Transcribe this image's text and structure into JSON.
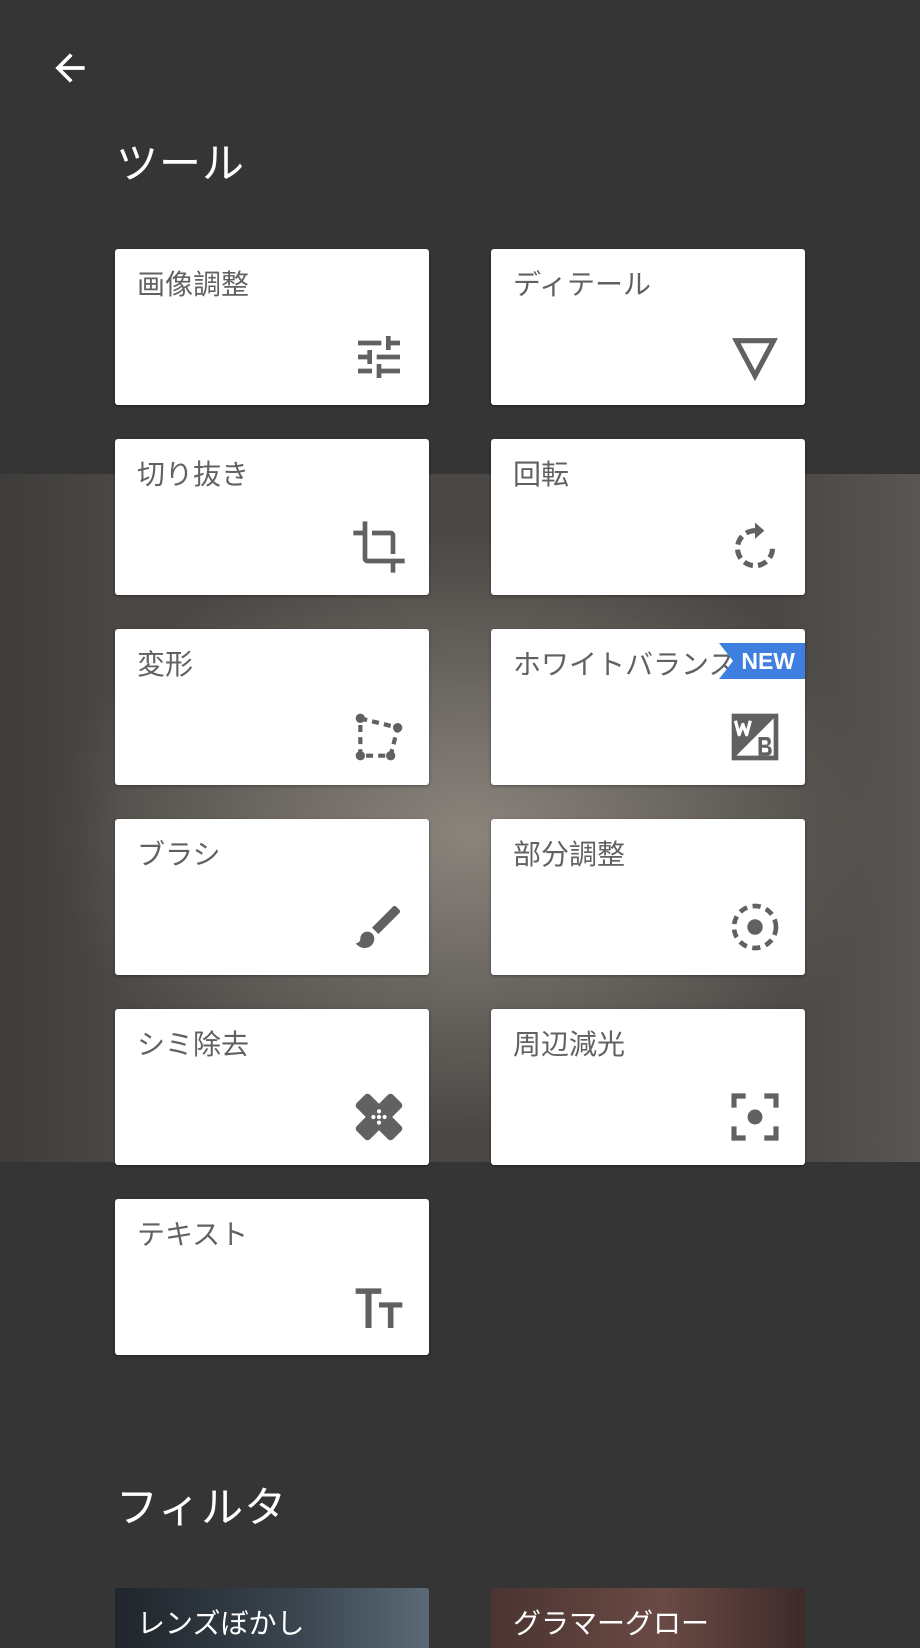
{
  "header": {
    "back_icon": "arrow-back-icon"
  },
  "tools": {
    "title": "ツール",
    "items": [
      {
        "label": "画像調整",
        "icon": "tune-sliders-icon"
      },
      {
        "label": "ディテール",
        "icon": "triangle-down-icon"
      },
      {
        "label": "切り抜き",
        "icon": "crop-icon"
      },
      {
        "label": "回転",
        "icon": "rotate-icon"
      },
      {
        "label": "変形",
        "icon": "perspective-icon"
      },
      {
        "label": "ホワイトバランス",
        "icon": "white-balance-icon",
        "badge": "NEW"
      },
      {
        "label": "ブラシ",
        "icon": "brush-icon"
      },
      {
        "label": "部分調整",
        "icon": "selective-adjust-icon"
      },
      {
        "label": "シミ除去",
        "icon": "healing-bandage-icon"
      },
      {
        "label": "周辺減光",
        "icon": "vignette-icon"
      },
      {
        "label": "テキスト",
        "icon": "text-icon"
      }
    ]
  },
  "filters": {
    "title": "フィルタ",
    "items": [
      {
        "label": "レンズぼかし"
      },
      {
        "label": "グラマーグロー"
      }
    ]
  },
  "colors": {
    "background": "#353535",
    "card": "#ffffff",
    "label": "#616161",
    "icon": "#616161",
    "badge": "#3f7fe0"
  }
}
